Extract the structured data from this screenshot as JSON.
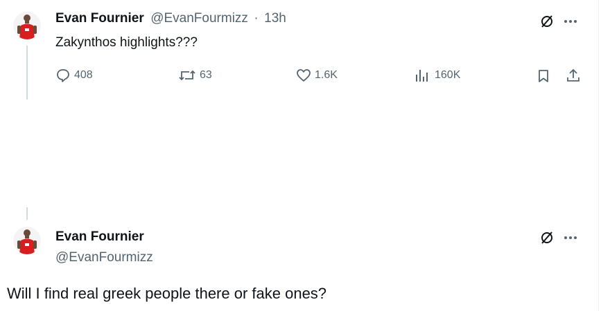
{
  "tweet1": {
    "display_name": "Evan Fournier",
    "handle": "@EvanFourmizz",
    "separator": "·",
    "time": "13h",
    "text": "Zakynthos highlights???",
    "actions": {
      "replies": "408",
      "reposts": "63",
      "likes": "1.6K",
      "views": "160K"
    }
  },
  "tweet2": {
    "display_name": "Evan Fournier",
    "handle": "@EvanFourmizz",
    "text": "Will I find real greek people there or fake ones?"
  },
  "icons": {
    "grok": "grok-icon",
    "more": "more-icon",
    "reply": "reply-icon",
    "repost": "repost-icon",
    "like": "like-icon",
    "views": "views-icon",
    "bookmark": "bookmark-icon",
    "share": "share-icon"
  },
  "colors": {
    "text": "#0f1419",
    "secondary": "#536471",
    "avatar_jersey": "#d81e1e"
  }
}
